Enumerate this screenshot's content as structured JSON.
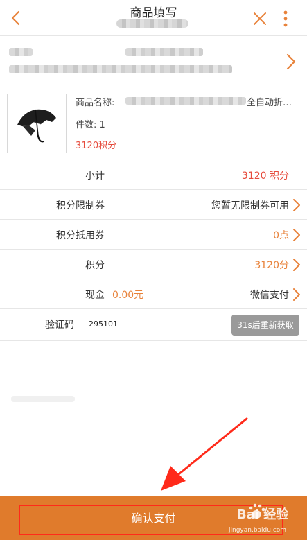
{
  "header": {
    "title": "商品填写"
  },
  "product": {
    "name_label": "商品名称:",
    "name_tail": "全自动折…",
    "qty_text": "件数:  1",
    "points_text": "3120积分"
  },
  "rows": {
    "subtotal": {
      "label": "小计",
      "value": "3120 积分"
    },
    "limit_coupon": {
      "label": "积分限制券",
      "value": "您暂无限制券可用"
    },
    "deduct_coupon": {
      "label": "积分抵用券",
      "value": "0点"
    },
    "points": {
      "label": "积分",
      "value": "3120分"
    },
    "cash": {
      "label": "现金",
      "amount": "0.00元",
      "method": "微信支付"
    },
    "verify": {
      "label": "验证码",
      "code": "295101",
      "resend": "31s后重新获取"
    }
  },
  "bottom": {
    "confirm_label": "确认支付",
    "watermark_text": "Bai 经验",
    "watermark_url": "jingyan.baidu.com"
  },
  "colors": {
    "accent": "#e8823a",
    "points_red": "#e64b3c",
    "bar": "#e07b2c",
    "highlight": "#ff2a1a"
  },
  "icons": [
    "back-arrow-icon",
    "close-icon",
    "more-vertical-icon",
    "chevron-right-icon",
    "umbrella-image",
    "annotation-arrow",
    "baidu-paw-icon"
  ]
}
